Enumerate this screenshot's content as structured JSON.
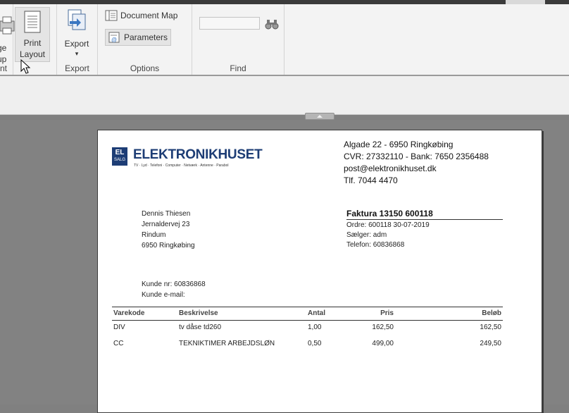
{
  "ribbon": {
    "page_setup_label": "Page Setup",
    "page_setup_partial": [
      "ge",
      "up"
    ],
    "print_layout_lines": [
      "Print",
      "Layout"
    ],
    "export_label": "Export",
    "export_arrow": "▾",
    "document_map_label": "Document Map",
    "parameters_label": "Parameters",
    "groups": {
      "first_partial": "nt",
      "export": "Export",
      "options": "Options",
      "find": "Find"
    },
    "find_value": ""
  },
  "invoice": {
    "company_name": "ELEKTRONIKHUSET",
    "company_tagline": "TV · Lyd · Telefoni · Computer · Netværk · Antenne · Parabol",
    "logo_text": [
      "EL",
      "SALG"
    ],
    "address_line": "Algade 22 - 6950 Ringkøbing",
    "cvr_line": "CVR: 27332110 - Bank: 7650 2356488",
    "email_line": "post@elektronikhuset.dk",
    "phone_line": "Tlf.  7044 4470",
    "customer": [
      "Dennis Thiesen",
      "Jernaldervej 23",
      "Rindum",
      "6950 Ringkøbing"
    ],
    "invoice_title": "Faktura 13150 600118",
    "order_line": "Ordre: 600118 30-07-2019",
    "seller_line": "Sælger: adm",
    "telefon_line": "Telefon: 60836868",
    "customer_no": "Kunde nr: 60836868",
    "customer_email": "Kunde e-mail:",
    "columns": [
      "Varekode",
      "Beskrivelse",
      "Antal",
      "Pris",
      "Beløb"
    ],
    "rows": [
      {
        "code": "DIV",
        "desc": "tv dåse td260",
        "qty": "1,00",
        "price": "162,50",
        "amount": "162,50"
      },
      {
        "code": "CC",
        "desc": "TEKNIKTIMER ARBEJDSLØN",
        "qty": "0,50",
        "price": "499,00",
        "amount": "249,50"
      }
    ]
  }
}
